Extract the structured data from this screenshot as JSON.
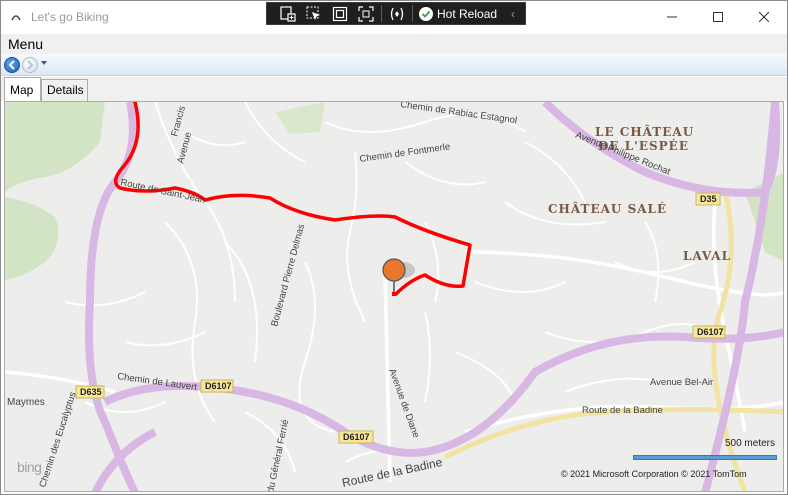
{
  "window": {
    "title": "Let's go Biking",
    "controls": {
      "minimize": "minimize-icon",
      "maximize": "maximize-icon",
      "close": "close-icon"
    }
  },
  "devbar": {
    "tools": [
      "live-visual-tree-icon",
      "select-element-icon",
      "display-layout-adorners-icon",
      "track-focus-icon",
      "binding-failures-icon"
    ],
    "hot_reload_label": "Hot Reload",
    "collapse_glyph": "‹"
  },
  "menu": {
    "label": "Menu"
  },
  "nav": {
    "back": "back-arrow-icon",
    "forward": "forward-arrow-icon"
  },
  "tabs": [
    {
      "label": "Map",
      "selected": true
    },
    {
      "label": "Details",
      "selected": false
    }
  ],
  "map": {
    "place_labels": {
      "chateau_espee_1": "LE CHÂTEAU",
      "chateau_espee_2": "DE L'ESPÉE",
      "chateau_sale": "CHÂTEAU SALÉ",
      "laval": "LAVAL",
      "maymes": "Maymes"
    },
    "road_labels": {
      "rabiac": "Chemin de Rabiac Estagnol",
      "fontmerle": "Chemin de Fontmerle",
      "rochat": "Avenue Philippe Rochat",
      "d35": "D35",
      "pierre_delmas": "Boulevard Pierre Delmas",
      "d6107_right": "D6107",
      "bel_air": "Avenue Bel-Air",
      "badine_right": "Route de la Badine",
      "lauvert": "Chemin de Lauvert",
      "d6107_left": "D6107",
      "d635": "D635",
      "eucalyptus": "Chemin des Eucalyptus",
      "diane": "Avenue de Diane",
      "general_ferrie": "du Général Ferrié",
      "d6107_bottom": "D6107",
      "badine_bottom": "Route de la Badine",
      "route_left": "Route de Saint-Jean",
      "avenue_left": "Avenue",
      "francis": "Francis"
    },
    "scale_label": "500 meters",
    "copyright": "© 2021 Microsoft Corporation   © 2021 TomTom",
    "brand": "bing",
    "route_color": "#ff0000",
    "pin_color": "#e8772e"
  }
}
